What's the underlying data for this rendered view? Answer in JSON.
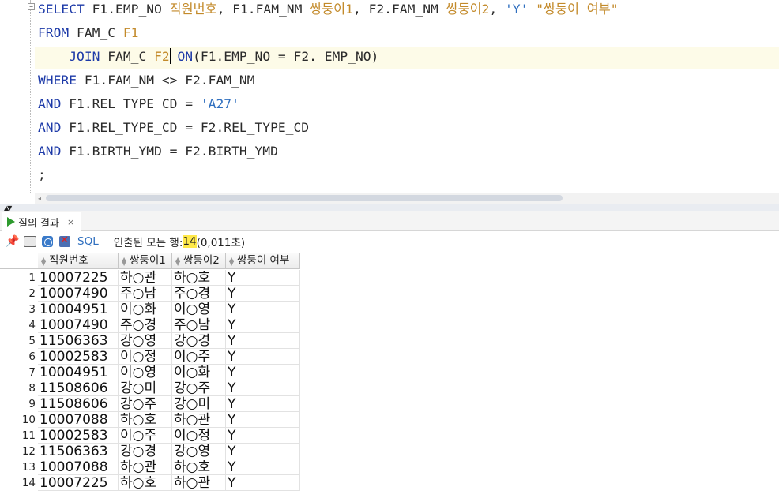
{
  "editor": {
    "lines": [
      [
        {
          "t": "SELECT ",
          "c": "kw"
        },
        {
          "t": "F1.EMP_NO ",
          "c": ""
        },
        {
          "t": "직원번호",
          "c": "alias"
        },
        {
          "t": ", F1.FAM_NM ",
          "c": ""
        },
        {
          "t": "쌍둥이1",
          "c": "alias"
        },
        {
          "t": ", F2.FAM_NM ",
          "c": ""
        },
        {
          "t": "쌍둥이2",
          "c": "alias"
        },
        {
          "t": ", ",
          "c": ""
        },
        {
          "t": "'Y'",
          "c": "str"
        },
        {
          "t": " ",
          "c": ""
        },
        {
          "t": "\"쌍둥이 여부\"",
          "c": "alias"
        }
      ],
      [
        {
          "t": "FROM ",
          "c": "kw"
        },
        {
          "t": "FAM_C ",
          "c": ""
        },
        {
          "t": "F1",
          "c": "alias"
        }
      ],
      [
        {
          "t": "    ",
          "c": ""
        },
        {
          "t": "JOIN ",
          "c": "kw"
        },
        {
          "t": "FAM_C ",
          "c": ""
        },
        {
          "t": "F2",
          "c": "alias"
        },
        {
          "t": "|",
          "c": "caret"
        },
        {
          "t": " ",
          "c": ""
        },
        {
          "t": "ON",
          "c": "kw"
        },
        {
          "t": "(F1.EMP_NO = F2. EMP_NO)",
          "c": ""
        }
      ],
      [
        {
          "t": "WHERE ",
          "c": "kw"
        },
        {
          "t": "F1.FAM_NM <> F2.FAM_NM",
          "c": ""
        }
      ],
      [
        {
          "t": "AND ",
          "c": "kw"
        },
        {
          "t": "F1.REL_TYPE_CD = ",
          "c": ""
        },
        {
          "t": "'A27'",
          "c": "str"
        }
      ],
      [
        {
          "t": "AND ",
          "c": "kw"
        },
        {
          "t": "F1.REL_TYPE_CD = F2.REL_TYPE_CD",
          "c": ""
        }
      ],
      [
        {
          "t": "AND ",
          "c": "kw"
        },
        {
          "t": "F1.BIRTH_YMD = F2.BIRTH_YMD",
          "c": ""
        }
      ],
      [
        {
          "t": ";",
          "c": ""
        }
      ]
    ],
    "current_line_index": 2
  },
  "results_tab": {
    "label": "질의 결과",
    "close": "×"
  },
  "toolbar": {
    "sql_label": "SQL",
    "fetched_label": "인출된 모든 행: ",
    "fetched_count": "14",
    "fetched_time": "(0,011초)"
  },
  "grid": {
    "columns": [
      "직원번호",
      "쌍둥이1",
      "쌍둥이2",
      "쌍둥이 여부"
    ],
    "rows": [
      [
        "1",
        "10007225",
        "하○관",
        "하○호",
        "Y"
      ],
      [
        "2",
        "10007490",
        "주○남",
        "주○경",
        "Y"
      ],
      [
        "3",
        "10004951",
        "이○화",
        "이○영",
        "Y"
      ],
      [
        "4",
        "10007490",
        "주○경",
        "주○남",
        "Y"
      ],
      [
        "5",
        "11506363",
        "강○영",
        "강○경",
        "Y"
      ],
      [
        "6",
        "10002583",
        "이○정",
        "이○주",
        "Y"
      ],
      [
        "7",
        "10004951",
        "이○영",
        "이○화",
        "Y"
      ],
      [
        "8",
        "11508606",
        "강○미",
        "강○주",
        "Y"
      ],
      [
        "9",
        "11508606",
        "강○주",
        "강○미",
        "Y"
      ],
      [
        "10",
        "10007088",
        "하○호",
        "하○관",
        "Y"
      ],
      [
        "11",
        "10002583",
        "이○주",
        "이○정",
        "Y"
      ],
      [
        "12",
        "11506363",
        "강○경",
        "강○영",
        "Y"
      ],
      [
        "13",
        "10007088",
        "하○관",
        "하○호",
        "Y"
      ],
      [
        "14",
        "10007225",
        "하○호",
        "하○관",
        "Y"
      ]
    ]
  }
}
